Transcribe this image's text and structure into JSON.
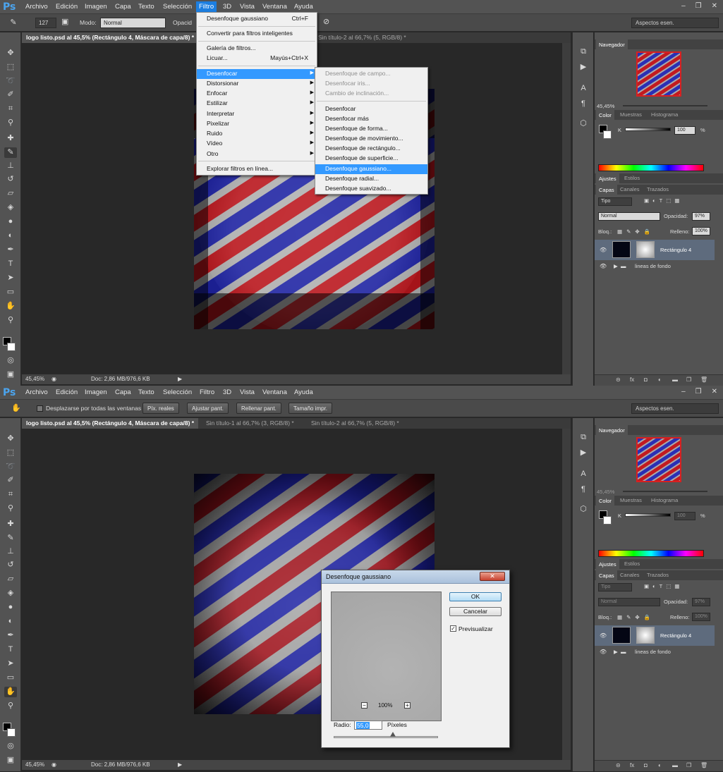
{
  "menubar": {
    "logo": "Ps",
    "items": [
      "Archivo",
      "Edición",
      "Imagen",
      "Capa",
      "Texto",
      "Selección",
      "Filtro",
      "3D",
      "Vista",
      "Ventana",
      "Ayuda"
    ],
    "active_item": "Filtro",
    "window_controls": [
      "‒",
      "❐",
      "✕"
    ]
  },
  "options1": {
    "brush_size": "127",
    "mode_label": "Modo:",
    "mode_value": "Normal",
    "opacity_label": "Opacid"
  },
  "options2": {
    "scroll_all_label": "Desplazarse por todas las ventanas",
    "buttons": [
      "Píx. reales",
      "Ajustar pant.",
      "Rellenar pant.",
      "Tamaño impr."
    ]
  },
  "workspace": "Aspectos esen.",
  "doc_tabs1": [
    {
      "label": "logo listo.psd al 45,5% (Rectángulo 4, Máscara de capa/8) *"
    },
    {
      "label": "Sin título-2 al 66,7% (5, RGB/8) *"
    }
  ],
  "doc_tabs2": [
    {
      "label": "logo listo.psd al 45,5% (Rectángulo 4, Máscara de capa/8) *"
    },
    {
      "label": "Sin título-1 al 66,7% (3, RGB/8) *"
    },
    {
      "label": "Sin título-2 al 66,7% (5, RGB/8) *"
    }
  ],
  "status": {
    "zoom": "45,45%",
    "doc": "Doc: 2,86 MB/976,6 KB"
  },
  "filter_menu": {
    "items": [
      {
        "label": "Desenfoque gaussiano",
        "shortcut": "Ctrl+F"
      },
      {
        "label": "Convertir para filtros inteligentes"
      },
      {
        "label": "Galería de filtros..."
      },
      {
        "label": "Licuar...",
        "shortcut": "Mayús+Ctrl+X"
      },
      {
        "label": "Desenfocar"
      },
      {
        "label": "Distorsionar"
      },
      {
        "label": "Enfocar"
      },
      {
        "label": "Estilizar"
      },
      {
        "label": "Interpretar"
      },
      {
        "label": "Pixelizar"
      },
      {
        "label": "Ruido"
      },
      {
        "label": "Vídeo"
      },
      {
        "label": "Otro"
      },
      {
        "label": "Explorar filtros en línea..."
      }
    ]
  },
  "blur_submenu": {
    "items": [
      "Desenfoque de campo...",
      "Desenfocar iris...",
      "Cambio de inclinación...",
      "Desenfocar",
      "Desenfocar más",
      "Desenfoque de forma...",
      "Desenfoque de movimiento...",
      "Desenfoque de rectángulo...",
      "Desenfoque de superficie...",
      "Desenfoque gaussiano...",
      "Desenfoque radial...",
      "Desenfoque suavizado..."
    ]
  },
  "panels": {
    "navigator_tab": "Navegador",
    "nav_zoom": "45,45%",
    "color_tabs": [
      "Color",
      "Muestras",
      "Histograma"
    ],
    "k_label": "K",
    "k_value": "100",
    "k_unit": "%",
    "adjust_tabs": [
      "Ajustes",
      "Estilos"
    ],
    "layer_tabs": [
      "Capas",
      "Canales",
      "Trazados"
    ],
    "kind": "Tipo",
    "blend": "Normal",
    "opacity_label": "Opacidad:",
    "opacity_value": "97%",
    "lock_label": "Bloq.:",
    "fill_label": "Relleno:",
    "fill_value": "100%",
    "layers": [
      "Rectángulo 4",
      "lineas de fondo"
    ]
  },
  "dialog": {
    "title": "Desenfoque gaussiano",
    "ok": "OK",
    "cancel": "Cancelar",
    "preview_label": "Previsualizar",
    "zoom": "100%",
    "radius_label": "Radio:",
    "radius_value": "55,0",
    "unit": "Píxeles"
  }
}
